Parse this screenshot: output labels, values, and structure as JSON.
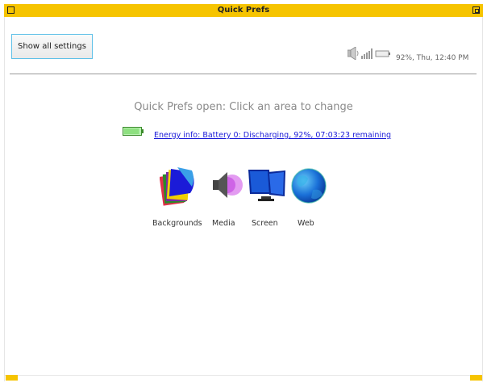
{
  "window": {
    "title": "Quick Prefs"
  },
  "toolbar": {
    "show_all_label": "Show all settings"
  },
  "status": {
    "text": "92%, Thu, 12:40 PM",
    "battery_percent": 92
  },
  "main": {
    "headline": "Quick Prefs open: Click an area to change",
    "energy_link": "Energy info: Battery 0: Discharging, 92%, 07:03:23 remaining"
  },
  "items": [
    {
      "label": "Backgrounds",
      "icon": "backgrounds-icon"
    },
    {
      "label": "Media",
      "icon": "media-icon"
    },
    {
      "label": "Screen",
      "icon": "screen-icon"
    },
    {
      "label": "Web",
      "icon": "web-icon"
    }
  ],
  "colors": {
    "titlebar": "#f6c400",
    "link": "#1a1ad8",
    "focus": "#5ec0e8"
  }
}
